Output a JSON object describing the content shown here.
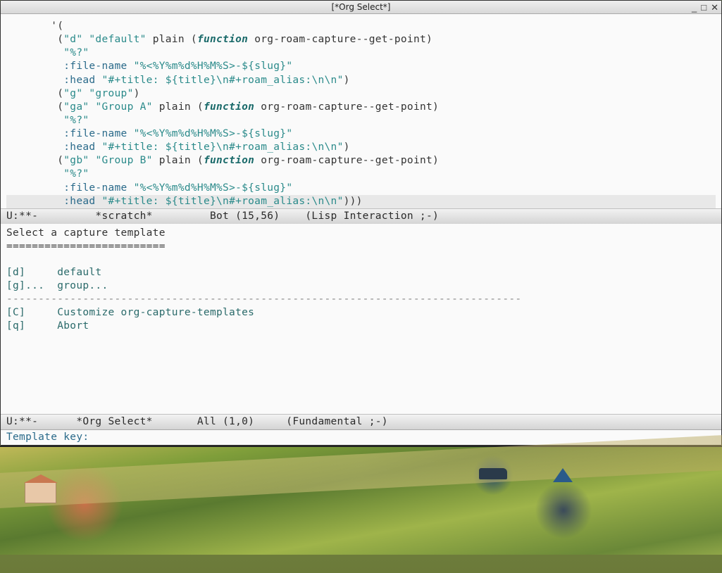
{
  "titlebar": {
    "title": "[*Org Select*]"
  },
  "code": {
    "l01_indent": "       ",
    "l01_paren": "'(",
    "l02_indent": "        (",
    "l02_s1": "\"d\"",
    "l02_s2": "\"default\"",
    "l02_plain": " plain (",
    "l02_func": "function",
    "l02_rest": " org-roam-capture--get-point)",
    "l03_indent": "         ",
    "l03_s": "\"%?\"",
    "l04_indent": "         ",
    "l04_key": ":file-name",
    "l04_val": "\"%<%Y%m%d%H%M%S>-${slug}\"",
    "l05_indent": "         ",
    "l05_key": ":head",
    "l05_val": "\"#+title: ${title}\\n#+roam_alias:\\n\\n\"",
    "l05_close": ")",
    "l06_indent": "        (",
    "l06_s1": "\"g\"",
    "l06_s2": "\"group\"",
    "l06_close": ")",
    "l07_indent": "        (",
    "l07_s1": "\"ga\"",
    "l07_s2": "\"Group A\"",
    "l07_plain": " plain (",
    "l07_func": "function",
    "l07_rest": " org-roam-capture--get-point)",
    "l08_indent": "         ",
    "l08_s": "\"%?\"",
    "l09_indent": "         ",
    "l09_key": ":file-name",
    "l09_val": "\"%<%Y%m%d%H%M%S>-${slug}\"",
    "l10_indent": "         ",
    "l10_key": ":head",
    "l10_val": "\"#+title: ${title}\\n#+roam_alias:\\n\\n\"",
    "l10_close": ")",
    "l11_indent": "        (",
    "l11_s1": "\"gb\"",
    "l11_s2": "\"Group B\"",
    "l11_plain": " plain (",
    "l11_func": "function",
    "l11_rest": " org-roam-capture--get-point)",
    "l12_indent": "         ",
    "l12_s": "\"%?\"",
    "l13_indent": "         ",
    "l13_key": ":file-name",
    "l13_val": "\"%<%Y%m%d%H%M%S>-${slug}\"",
    "l14_indent": "         ",
    "l14_key": ":head",
    "l14_val": "\"#+title: ${title}\\n#+roam_alias:\\n\\n\"",
    "l14_close": ")))"
  },
  "modeline1": {
    "text": "U:**-         *scratch*         Bot (15,56)    (Lisp Interaction ;-) "
  },
  "select": {
    "head": "Select a capture template",
    "sep": "=========================",
    "blank": "",
    "r1": "[d]     default",
    "r2": "[g]...  group...",
    "dash": "---------------------------------------------------------------------------------",
    "r3": "[C]     Customize org-capture-templates",
    "r4": "[q]     Abort"
  },
  "modeline2": {
    "text": "U:**-      *Org Select*       All (1,0)     (Fundamental ;-) "
  },
  "minibuffer": {
    "prompt": "Template key: "
  }
}
